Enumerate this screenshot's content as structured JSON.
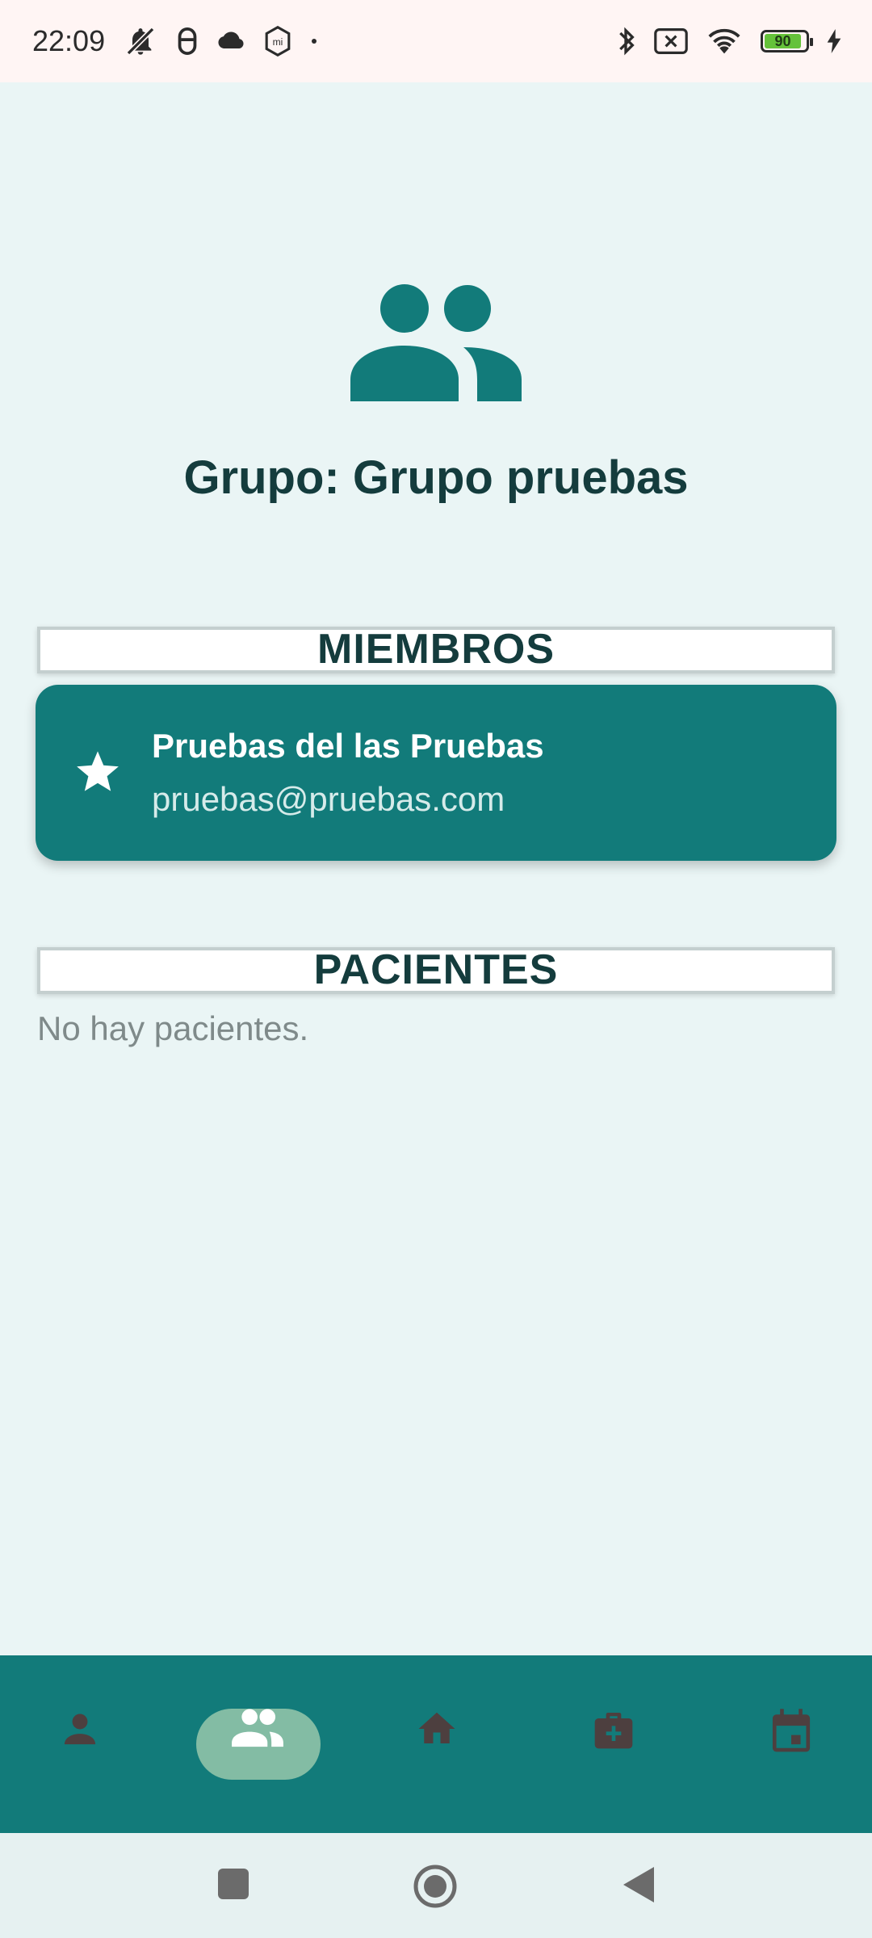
{
  "status_bar": {
    "time": "22:09",
    "left_icons": [
      "bell-off-icon",
      "hood-icon",
      "cloud-icon",
      "mi-icon",
      "dot-icon"
    ],
    "right_icons": [
      "bluetooth-icon",
      "no-sim-icon",
      "wifi-icon",
      "battery-icon",
      "charging-icon"
    ],
    "battery_level": "90"
  },
  "header": {
    "icon": "group-icon",
    "title": "Grupo: Grupo pruebas"
  },
  "sections": {
    "members_title": "MIEMBROS",
    "patients_title": "PACIENTES"
  },
  "members": [
    {
      "icon": "star-icon",
      "name": "Pruebas del las Pruebas",
      "email": "pruebas@pruebas.com"
    }
  ],
  "patients": {
    "empty_text": "No hay pacientes."
  },
  "bottom_nav": {
    "items": [
      "person-icon",
      "group-icon",
      "home-icon",
      "medical-kit-icon",
      "calendar-icon"
    ],
    "active_index": 1
  },
  "system_nav": [
    "recents-icon",
    "home-circle-icon",
    "back-icon"
  ],
  "colors": {
    "primary": "#127b7a",
    "background": "#eaf5f5",
    "title_text": "#143c3d",
    "active_pill": "#83bca4"
  }
}
